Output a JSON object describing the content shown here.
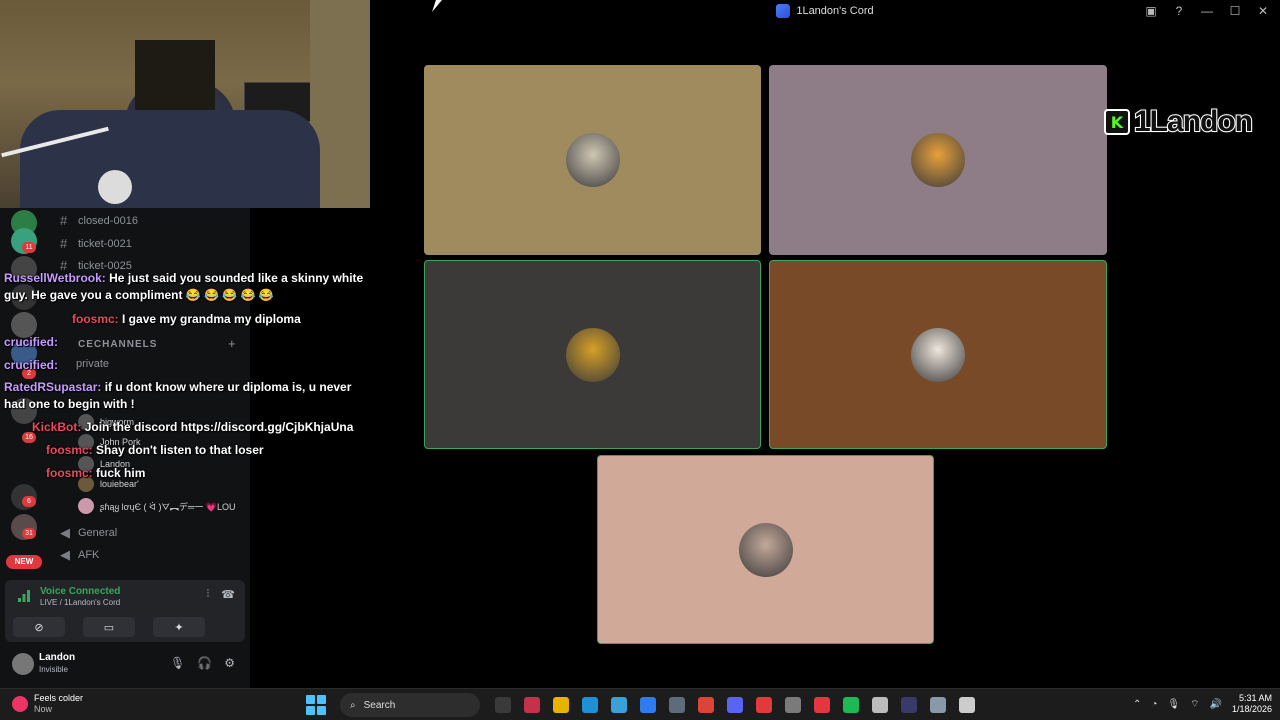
{
  "window": {
    "title": "1Landon's Cord"
  },
  "streamer_badge": {
    "name": "1Landon",
    "platform_icon": "kick-logo",
    "platform_letter": "K"
  },
  "channels": [
    {
      "name": "closed-0016",
      "type": "text"
    },
    {
      "name": "ticket-0021",
      "type": "text"
    },
    {
      "name": "ticket-0025",
      "type": "text"
    }
  ],
  "voice_category": {
    "label": "CECHANNELS",
    "channel": "private"
  },
  "voice_users": [
    {
      "name": "bigworm"
    },
    {
      "name": "John Pork"
    },
    {
      "name": "Landon"
    },
    {
      "name": "louiebear'"
    },
    {
      "name": "ʂɦąყ ƖơųЄ ( ᐛ )ᗊ︻デ═一  💗LOU"
    }
  ],
  "voice_channels_bottom": [
    {
      "name": "General"
    },
    {
      "name": "AFK"
    }
  ],
  "server_badges": [
    "11",
    "2",
    "16",
    "6",
    "31"
  ],
  "new_badge": "NEW",
  "chat": [
    {
      "user": "RussellWetbrook:",
      "user_color": "#c79bff",
      "text": "He just said you sounded like a skinny white guy. He gave you a compliment 😂 😂 😂 😂 😂"
    },
    {
      "user": "foosmc:",
      "user_color": "#e84a5f",
      "text": "I gave my grandma my diploma"
    },
    {
      "user": "crucified:",
      "user_color": "#c79bff",
      "text": ""
    },
    {
      "user": "crucified:",
      "user_color": "#c79bff",
      "text": ""
    },
    {
      "user": "RatedRSupastar:",
      "user_color": "#c79bff",
      "text": "if u dont know where ur diploma is, u never had one to begin with !"
    },
    {
      "user": "KickBot:",
      "user_color": "#e84a5f",
      "text": "Join the discord https://discord.gg/CjbKhjaUna"
    },
    {
      "user": "foosmc:",
      "user_color": "#e84a5f",
      "text": "Shay don't listen to that loser"
    },
    {
      "user": "foosmc:",
      "user_color": "#e84a5f",
      "text": "fuck him"
    }
  ],
  "voice_panel": {
    "status": "Voice Connected",
    "sub": "LIVE / 1Landon's Cord",
    "buttons": [
      "camera-off-icon",
      "screen-share-icon",
      "activities-icon",
      "soundboard-icon"
    ]
  },
  "user_panel": {
    "name": "Landon",
    "status": "Invisible"
  },
  "tiles": [
    {
      "bg": "#9f8b5e",
      "avatar_bg": "#cfc7b3",
      "speaking": false
    },
    {
      "bg": "#8e7c86",
      "avatar_bg": "#e7a13b",
      "speaking": false
    },
    {
      "bg": "#3b3a38",
      "avatar_bg": "#d7a027",
      "speaking": true
    },
    {
      "bg": "#784a28",
      "avatar_bg": "#efe6dc",
      "speaking": true
    },
    {
      "bg": "#d1a999",
      "avatar_bg": "#c3a89a",
      "speaking": true
    }
  ],
  "taskbar": {
    "weather_title": "Feels colder",
    "weather_sub": "Now",
    "search_placeholder": "Search",
    "time": "5:31 AM",
    "date": "1/18/2026",
    "apps": [
      "#3a3a3a",
      "#c4314b",
      "#e8b300",
      "#1f8fd6",
      "#3aa0d8",
      "#2d7cf0",
      "#5e6b7a",
      "#db4437",
      "#5865f2",
      "#e03a3a",
      "#7a7a7a",
      "#e0383e",
      "#1db954",
      "#bbbbbb",
      "#3a3a6a",
      "#8899aa",
      "#cccccc"
    ]
  }
}
